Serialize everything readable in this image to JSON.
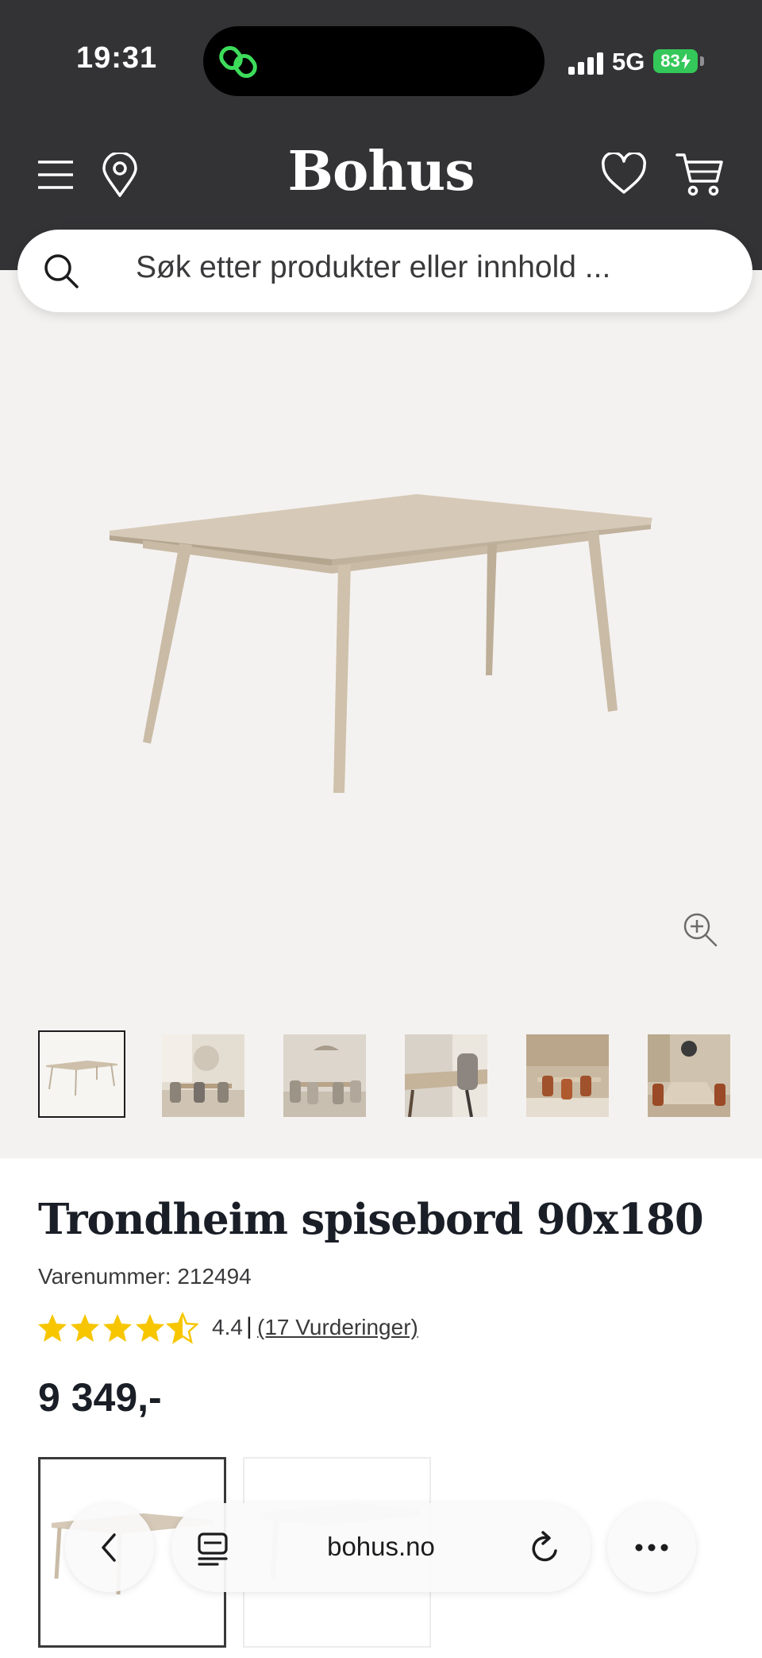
{
  "status_bar": {
    "time": "19:31",
    "network": "5G",
    "battery": "83"
  },
  "header": {
    "brand": "Bohus",
    "icons": [
      "menu-icon",
      "location-icon",
      "heart-icon",
      "cart-icon"
    ],
    "background": "#333336"
  },
  "search": {
    "placeholder": "Søk etter produkter eller innhold ..."
  },
  "gallery": {
    "background": "#f4f2f0",
    "selected_thumbnail": 0,
    "thumbnails": [
      "thumb-product",
      "thumb-room-1",
      "thumb-room-2",
      "thumb-closeup",
      "thumb-room-3",
      "thumb-room-4"
    ]
  },
  "product": {
    "title": "Trondheim spisebord 90x180",
    "sku_line": "Varenummer: 212494",
    "rating_value": "4.4",
    "rating_separator": "|",
    "rating_link": "(17 Vurderinger)",
    "rating_stars": 4.5,
    "price": "9 349,-",
    "star_color": "#f7c600"
  },
  "browser": {
    "url": "bohus.no"
  }
}
